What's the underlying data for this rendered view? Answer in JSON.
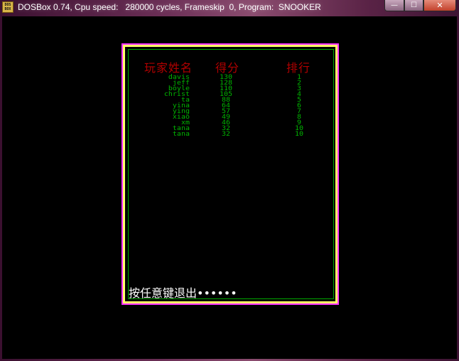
{
  "window": {
    "title": "DOSBox 0.74, Cpu speed:   280000 cycles, Frameskip  0, Program:  SNOOKER",
    "icon": "dosbox-icon",
    "icon_label": "DOS BOX",
    "controls": {
      "minimize": "—",
      "maximize": "☐",
      "close": "✕"
    }
  },
  "game": {
    "headers": {
      "name": "玩家姓名",
      "score": "得分",
      "rank": "排行"
    },
    "players": [
      {
        "name": "davis",
        "score": "130",
        "rank": "1"
      },
      {
        "name": "jeff",
        "score": "128",
        "rank": "2"
      },
      {
        "name": "boyle",
        "score": "110",
        "rank": "3"
      },
      {
        "name": "christ",
        "score": "105",
        "rank": "4"
      },
      {
        "name": "ta",
        "score": "88",
        "rank": "5"
      },
      {
        "name": "yina",
        "score": "64",
        "rank": "6"
      },
      {
        "name": "ying",
        "score": "57",
        "rank": "7"
      },
      {
        "name": "xiao",
        "score": "49",
        "rank": "8"
      },
      {
        "name": "xm",
        "score": "46",
        "rank": "9"
      },
      {
        "name": "tana",
        "score": "32",
        "rank": "10"
      },
      {
        "name": "tana",
        "score": "32",
        "rank": "10"
      }
    ],
    "exit_prompt": "按任意键退出••••••",
    "colors": {
      "header": "#b00000",
      "rows": "#00b400",
      "frame_outer": "#ff33ff",
      "frame_yellow": "#ffff66",
      "frame_inner": "#00a800"
    }
  }
}
